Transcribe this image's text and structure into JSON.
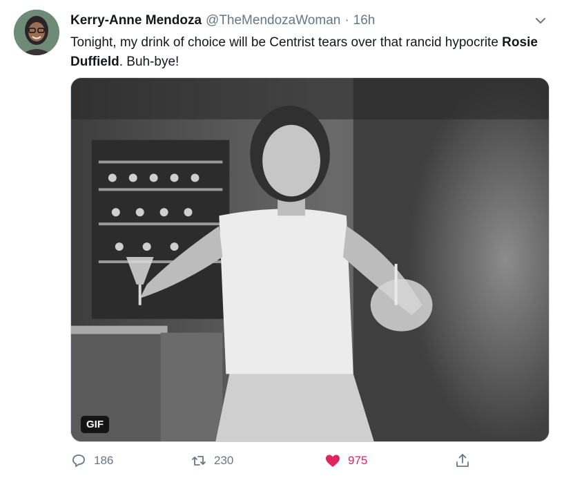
{
  "tweet": {
    "author_name": "Kerry-Anne Mendoza",
    "handle": "@TheMendozaWoman",
    "separator": "·",
    "time": "16h",
    "text_part1": "Tonight, my drink of choice will be Centrist tears over that rancid hypocrite ",
    "text_mention": "Rosie Duffield",
    "text_part2": ". Buh-bye!",
    "media_badge": "GIF"
  },
  "actions": {
    "reply_count": "186",
    "retweet_count": "230",
    "like_count": "975"
  },
  "icons": {
    "caret": "chevron-down-icon",
    "reply": "reply-icon",
    "retweet": "retweet-icon",
    "like": "heart-icon",
    "share": "share-icon"
  },
  "colors": {
    "like_active": "#e0245e",
    "secondary_text": "#657786"
  }
}
